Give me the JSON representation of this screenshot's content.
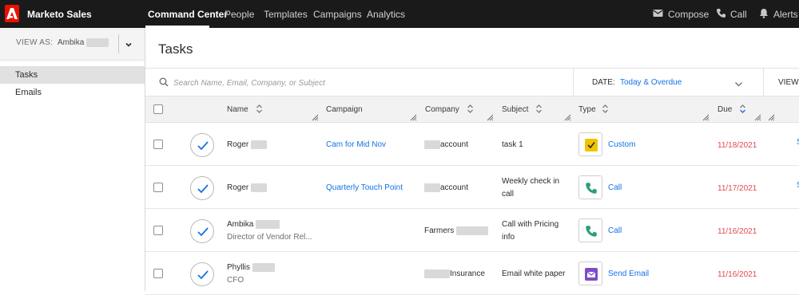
{
  "app": {
    "title": "Marketo Sales"
  },
  "nav": {
    "items": [
      {
        "label": "Command Center"
      },
      {
        "label": "People"
      },
      {
        "label": "Templates"
      },
      {
        "label": "Campaigns"
      },
      {
        "label": "Analytics"
      }
    ],
    "actions": {
      "compose": "Compose",
      "call": "Call",
      "alerts": "Alerts"
    }
  },
  "sidebar": {
    "view_as_label": "VIEW AS:",
    "view_as_user": "Ambika",
    "items": [
      {
        "label": "Tasks"
      },
      {
        "label": "Emails"
      }
    ]
  },
  "page": {
    "title": "Tasks"
  },
  "toolbar": {
    "search_placeholder": "Search Name, Email, Company, or Subject",
    "date_label": "DATE:",
    "date_value": "Today & Overdue",
    "view_label": "VIEW:"
  },
  "table": {
    "headers": {
      "name": "Name",
      "campaign": "Campaign",
      "company": "Company",
      "subject": "Subject",
      "type": "Type",
      "due": "Due"
    },
    "rows": [
      {
        "name": "Roger",
        "title": "",
        "campaign": "Cam for Mid Nov",
        "company": "account",
        "subject": "task 1",
        "subject2": "",
        "type": "Custom",
        "type_icon": "checkbox-icon",
        "due": "11/18/2021"
      },
      {
        "name": "Roger",
        "title": "",
        "campaign": "Quarterly Touch Point",
        "company": "account",
        "subject": "Weekly check in",
        "subject2": "call",
        "type": "Call",
        "type_icon": "phone-icon",
        "due": "11/17/2021"
      },
      {
        "name": "Ambika",
        "title": "Director of Vendor Rel...",
        "campaign": "",
        "company": "Farmers",
        "subject": "Call with Pricing",
        "subject2": "info",
        "type": "Call",
        "type_icon": "phone-icon",
        "due": "11/16/2021"
      },
      {
        "name": "Phyllis",
        "title": "CFO",
        "campaign": "",
        "company": "Insurance",
        "subject": "Email white paper",
        "subject2": "",
        "type": "Send Email",
        "type_icon": "email-icon",
        "due": "11/16/2021"
      }
    ]
  },
  "colors": {
    "accent": "#1473e6",
    "due": "#e34850",
    "brand": "#eb1000",
    "custom": "#f0c400",
    "call": "#2d9d78",
    "email": "#7e4cc8"
  }
}
